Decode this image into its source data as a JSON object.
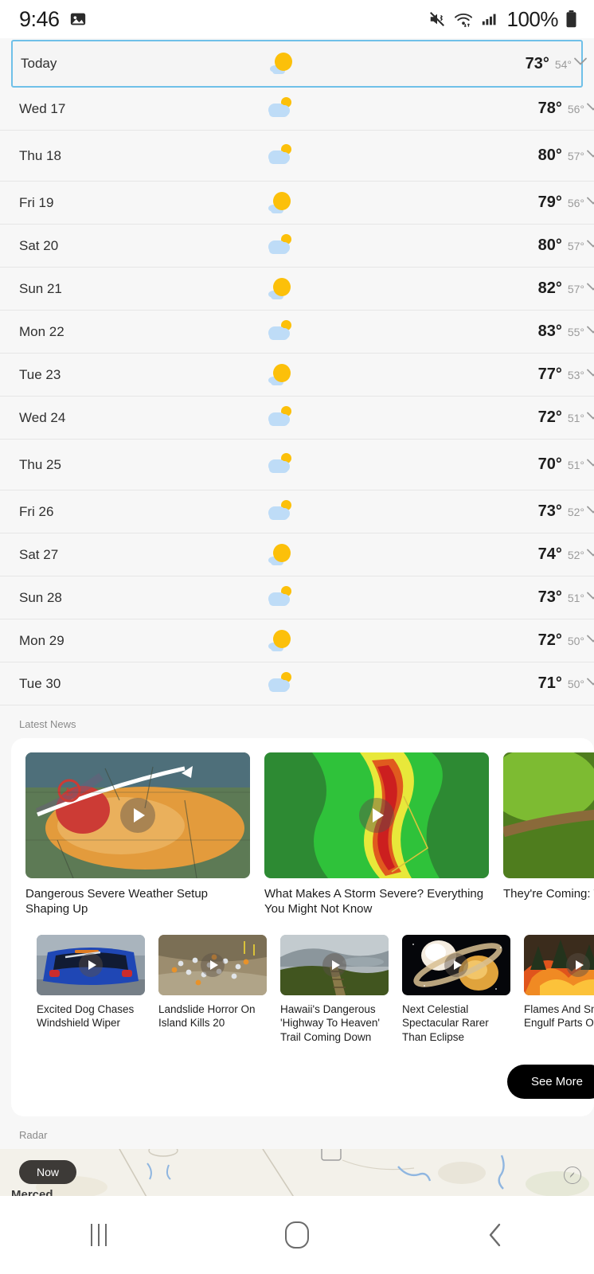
{
  "status_bar": {
    "time": "9:46",
    "battery_percent": "100%",
    "icons": [
      "image-icon",
      "mute-vibrate-icon",
      "wifi-icon",
      "signal-bars-icon",
      "battery-icon"
    ]
  },
  "forecast": {
    "rows": [
      {
        "day": "Today",
        "icon": "sunny",
        "high": "73°",
        "low": "54°",
        "selected": true,
        "tall": false
      },
      {
        "day": "Wed 17",
        "icon": "partly",
        "high": "78°",
        "low": "56°",
        "selected": false,
        "tall": false
      },
      {
        "day": "Thu 18",
        "icon": "partly",
        "high": "80°",
        "low": "57°",
        "selected": false,
        "tall": true
      },
      {
        "day": "Fri 19",
        "icon": "sunny",
        "high": "79°",
        "low": "56°",
        "selected": false,
        "tall": false
      },
      {
        "day": "Sat 20",
        "icon": "partly",
        "high": "80°",
        "low": "57°",
        "selected": false,
        "tall": false
      },
      {
        "day": "Sun 21",
        "icon": "sunny",
        "high": "82°",
        "low": "57°",
        "selected": false,
        "tall": false
      },
      {
        "day": "Mon 22",
        "icon": "partly",
        "high": "83°",
        "low": "55°",
        "selected": false,
        "tall": false
      },
      {
        "day": "Tue 23",
        "icon": "sunny",
        "high": "77°",
        "low": "53°",
        "selected": false,
        "tall": false
      },
      {
        "day": "Wed 24",
        "icon": "partly",
        "high": "72°",
        "low": "51°",
        "selected": false,
        "tall": false
      },
      {
        "day": "Thu 25",
        "icon": "partly",
        "high": "70°",
        "low": "51°",
        "selected": false,
        "tall": true
      },
      {
        "day": "Fri 26",
        "icon": "partly",
        "high": "73°",
        "low": "52°",
        "selected": false,
        "tall": false
      },
      {
        "day": "Sat 27",
        "icon": "sunny",
        "high": "74°",
        "low": "52°",
        "selected": false,
        "tall": false
      },
      {
        "day": "Sun 28",
        "icon": "partly",
        "high": "73°",
        "low": "51°",
        "selected": false,
        "tall": false
      },
      {
        "day": "Mon 29",
        "icon": "sunny",
        "high": "72°",
        "low": "50°",
        "selected": false,
        "tall": false
      },
      {
        "day": "Tue 30",
        "icon": "partly",
        "high": "71°",
        "low": "50°",
        "selected": false,
        "tall": false
      }
    ]
  },
  "news": {
    "section_label": "Latest News",
    "featured": [
      {
        "title": "Dangerous Severe Weather Setup Shaping Up",
        "thumb": "severe-weather-map"
      },
      {
        "title": "What Makes A Storm Severe? Everything You Might Not Know",
        "thumb": "radar-storm-map"
      },
      {
        "title": "They're Coming: Tril",
        "thumb": "cicada-branch-photo"
      }
    ],
    "small": [
      {
        "title": "Excited Dog Chases Windshield Wiper",
        "thumb": "blue-car-photo"
      },
      {
        "title": "Landslide Horror On Island Kills 20",
        "thumb": "landslide-crowd-photo"
      },
      {
        "title": "Hawaii's Dangerous 'Highway To Heaven' Trail Coming Down",
        "thumb": "hawaii-trail-photo"
      },
      {
        "title": "Next Celestial Spectacular Rarer Than Eclipse",
        "thumb": "planet-space-photo"
      },
      {
        "title": "Flames And Sm Engulf Parts Of",
        "thumb": "wildfire-photo"
      }
    ],
    "see_more_label": "See More"
  },
  "radar": {
    "section_label": "Radar",
    "time_pill": "Now",
    "map_label": "Merced"
  },
  "nav_bar": {
    "recents_label": "recents-button",
    "home_label": "home-button",
    "back_label": "back-button"
  },
  "colors": {
    "accent_blue": "#6fc0e8",
    "sun_yellow": "#fcc00a",
    "cloud_blue": "#bedcf7",
    "page_bg": "#f7f7f7"
  }
}
